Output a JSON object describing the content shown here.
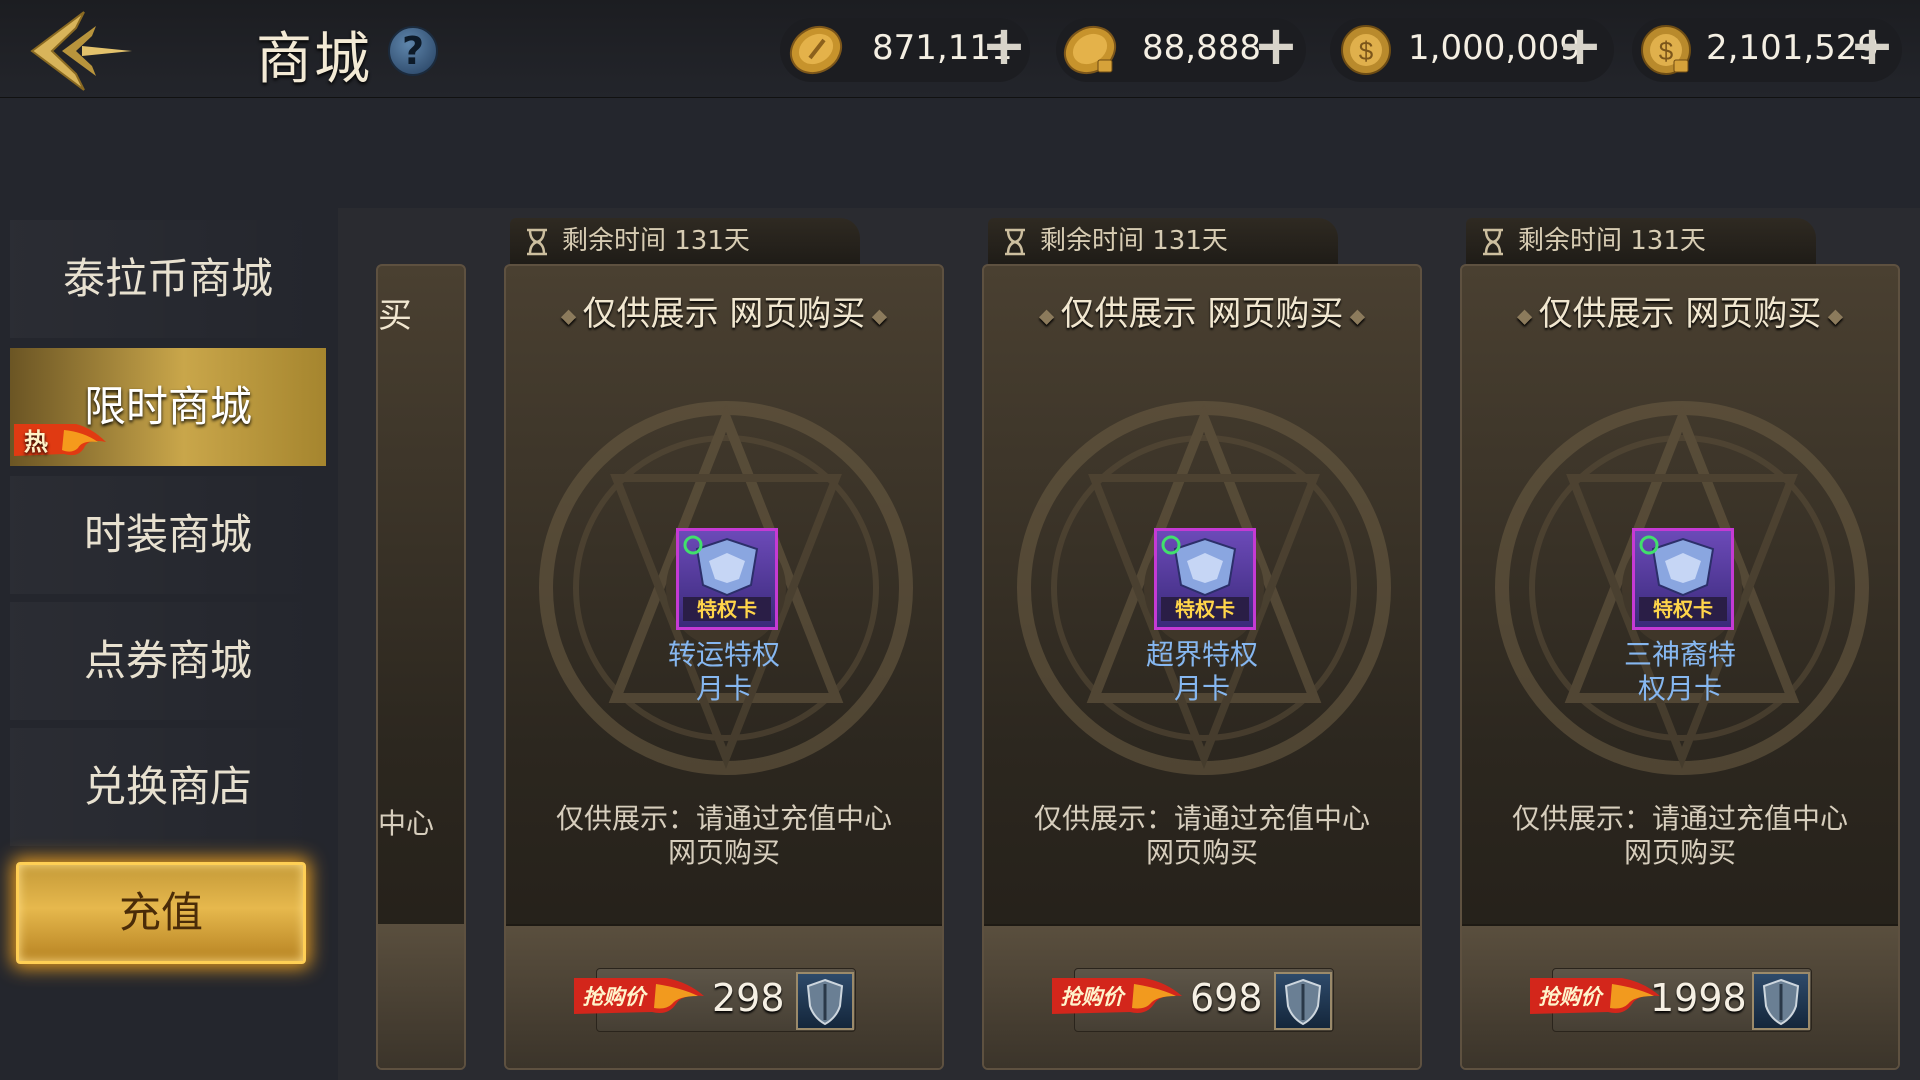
{
  "header": {
    "title": "商城",
    "help_glyph": "?",
    "currencies": [
      {
        "icon": "gold-coin-icon",
        "amount": "871,111",
        "plus": "+"
      },
      {
        "icon": "bound-gold-coin-icon",
        "amount": "88,888",
        "plus": "+"
      },
      {
        "icon": "tera-coin-icon",
        "amount": "1,000,009",
        "plus": "+"
      },
      {
        "icon": "bound-tera-coin-icon",
        "amount": "2,101,529",
        "plus": "+"
      }
    ]
  },
  "sidebar": {
    "items": [
      {
        "label": "泰拉币商城"
      },
      {
        "label": "限时商城",
        "badge": "热"
      },
      {
        "label": "时装商城"
      },
      {
        "label": "点券商城"
      },
      {
        "label": "兑换商店"
      }
    ],
    "active_index": 1,
    "recharge_label": "充值"
  },
  "partial_card": {
    "head_fragment": "买",
    "desc_fragment": "中心"
  },
  "cards": [
    {
      "timer": "剩余时间 131天",
      "head": "仅供展示 网页购买",
      "item_line1": "转运特权",
      "item_line2": "月卡",
      "icon_label": "特权卡",
      "desc_line1": "仅供展示：请通过充值中心",
      "desc_line2": "网页购买",
      "price_tag": "抢购价",
      "price": "298"
    },
    {
      "timer": "剩余时间 131天",
      "head": "仅供展示 网页购买",
      "item_line1": "超界特权",
      "item_line2": "月卡",
      "icon_label": "特权卡",
      "desc_line1": "仅供展示：请通过充值中心",
      "desc_line2": "网页购买",
      "price_tag": "抢购价",
      "price": "698"
    },
    {
      "timer": "剩余时间 131天",
      "head": "仅供展示 网页购买",
      "item_line1": "三神裔特",
      "item_line2": "权月卡",
      "icon_label": "特权卡",
      "desc_line1": "仅供展示：请通过充值中心",
      "desc_line2": "网页购买",
      "price_tag": "抢购价",
      "price": "1998"
    }
  ],
  "colors": {
    "accent_gold": "#c9a64a",
    "item_name_blue": "#86b7f0",
    "price_tag_red": "#d3261b"
  }
}
